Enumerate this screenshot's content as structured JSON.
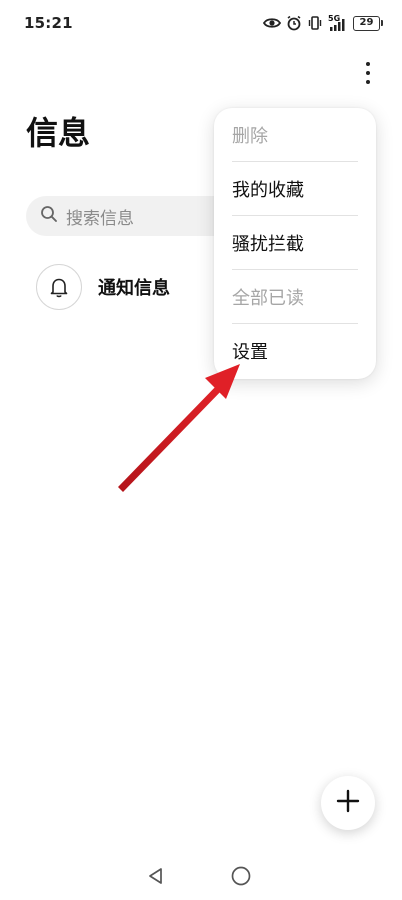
{
  "status_bar": {
    "time": "15:21",
    "network": "5G",
    "battery": "29",
    "icons": [
      "eye-icon",
      "alarm-icon",
      "vibrate-icon",
      "signal-icon",
      "battery-icon"
    ]
  },
  "header": {
    "title": "信息",
    "more_icon": "more-vertical-icon"
  },
  "search": {
    "placeholder": "搜索信息",
    "icon": "search-icon"
  },
  "notifications": {
    "label": "通知信息",
    "icon": "bell-icon"
  },
  "menu": {
    "items": [
      {
        "label": "删除",
        "enabled": false
      },
      {
        "label": "我的收藏",
        "enabled": true
      },
      {
        "label": "骚扰拦截",
        "enabled": true
      },
      {
        "label": "全部已读",
        "enabled": false
      },
      {
        "label": "设置",
        "enabled": true
      }
    ]
  },
  "fab": {
    "icon": "plus-icon"
  },
  "nav": {
    "icons": [
      "back-icon",
      "home-icon"
    ]
  },
  "colors": {
    "annotation_arrow": "#d81e22",
    "disabled_text": "#a6a6a6",
    "search_bg": "#f1f1f1"
  }
}
